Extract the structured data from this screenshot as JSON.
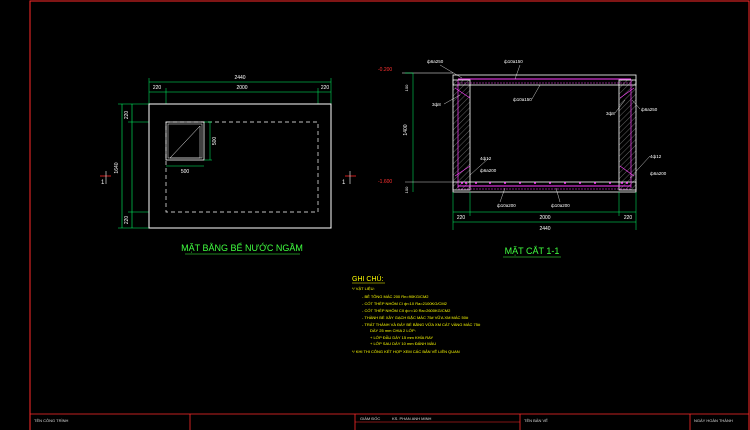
{
  "plan": {
    "title": "MẶT BẰNG BỂ NƯỚC NGẦM",
    "dim_total": "2440",
    "dim_left": "220",
    "dim_mid": "2000",
    "dim_right": "220",
    "dim_v_top": "220",
    "dim_v_mid": "1640",
    "dim_v_bot": "220",
    "opening_w": "500",
    "opening_h": "500",
    "section_mark": "1"
  },
  "section": {
    "title": "MẶT CẮT 1-1",
    "level_top": "-0.200",
    "level_bot": "-1.600",
    "dim_total": "2440",
    "dim_left": "220",
    "dim_mid": "2000",
    "dim_right": "220",
    "dim_height": "1400",
    "dim_top_slab": "100",
    "dim_bot_slab": "100",
    "rebar_top": "ф6a250",
    "rebar_top2": "ф10a150",
    "rebar_top3": "ф10a150",
    "rebar_side_right": "ф6a250",
    "rebar_3f8_left": "3ф8",
    "rebar_3f8_right": "3ф8",
    "rebar_4f12_left": "4ф12",
    "rebar_4f12_right": "4ф12",
    "rebar_bot_left": "ф6a200",
    "rebar_bot_right": "ф6a200",
    "rebar_bot_a": "ф10a200",
    "rebar_bot_b": "ф10a200"
  },
  "notes": {
    "heading": "GHI CHÚ:",
    "lines": [
      "*/ VẬT LIỆU:",
      "- BÊ TÔNG MÁC 200 Rn=90KG/CM2",
      "- CỐT THÉP NHÓM CI ф<10 Ra=2100KG/CM2",
      "- CỐT THÉP NHÓM CII ф>=10 Ra=2600KG/CM2",
      "- THÀNH BỂ XÂY GẠCH ĐẶC MÁC 75# VỮA XM MÁC 50#",
      "- TRÁT THÀNH VÀ ĐÁY BỂ BẰNG VỮA XM CÁT VÀNG MÁC 75#",
      "DÀY 25 mm CHIA 2 LỚP:",
      "+ LỚP ĐẦU DÀY 15 mm KHÍA RAY",
      "+ LỚP SAU DÀY 10 mm ĐÁNH MÀU",
      "*/ KHI THI CÔNG KẾT HỢP XEM CÁC BẢN VẼ LIÊN QUAN"
    ]
  },
  "title_block": {
    "project": "TÊN CÔNG TRÌNH",
    "director_label": "GIÁM ĐỐC",
    "director_name": "KS. PHAN ANH MINH",
    "drawing_name": "TÊN BẢN VẼ",
    "date": "NGÀY HOÀN THÀNH"
  },
  "colors": {
    "frame": "#ff2a2a",
    "outline": "#ffffff",
    "rebar": "#ff40ff",
    "dim": "#00ff66",
    "hatch": "#aaaaaa",
    "label_green": "#40ff40",
    "level_red": "#ff3030",
    "notes": "#ffff00"
  }
}
